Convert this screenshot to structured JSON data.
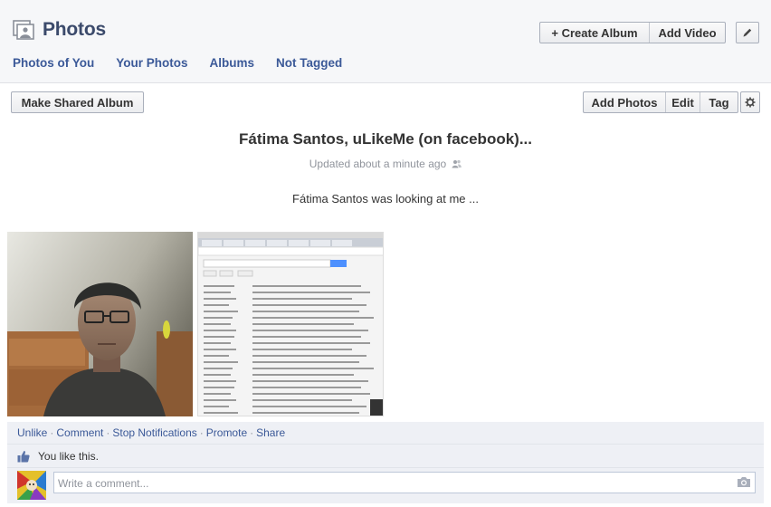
{
  "header": {
    "title": "Photos",
    "create_album": "+ Create Album",
    "add_video": "Add Video"
  },
  "nav": {
    "tabs": [
      {
        "label": "Photos of You"
      },
      {
        "label": "Your Photos"
      },
      {
        "label": "Albums"
      },
      {
        "label": "Not Tagged"
      }
    ]
  },
  "toolbar": {
    "make_shared_album": "Make Shared Album",
    "add_photos": "Add Photos",
    "edit": "Edit",
    "tag": "Tag"
  },
  "album": {
    "title": "Fátima Santos, uLikeMe (on facebook)...",
    "updated": "Updated about a minute ago",
    "description": "Fátima Santos was looking at me ..."
  },
  "ufi": {
    "actions": [
      "Unlike",
      "Comment",
      "Stop Notifications",
      "Promote",
      "Share"
    ],
    "likes_text": "You like this.",
    "comment_placeholder": "Write a comment..."
  },
  "colors": {
    "link": "#3b5998",
    "title": "#3b4a6b",
    "panel": "#eef0f5"
  }
}
